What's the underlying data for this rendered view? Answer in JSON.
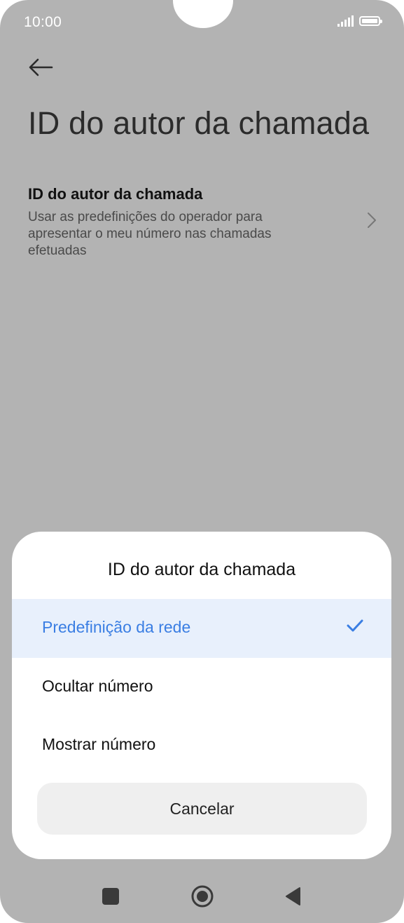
{
  "status_bar": {
    "time": "10:00",
    "signal_icon": "signal-icon",
    "battery_icon": "battery-icon"
  },
  "header": {
    "back_icon": "arrow-left-icon",
    "title": "ID do autor da chamada"
  },
  "setting": {
    "title": "ID do autor da chamada",
    "description": "Usar as predefinições do operador para apresentar o meu número nas chamadas efetuadas",
    "chevron_icon": "chevron-right-icon"
  },
  "dialog": {
    "title": "ID do autor da chamada",
    "options": [
      {
        "label": "Predefinição da rede",
        "selected": true
      },
      {
        "label": "Ocultar número",
        "selected": false
      },
      {
        "label": "Mostrar número",
        "selected": false
      }
    ],
    "check_icon": "checkmark-icon",
    "cancel_label": "Cancelar"
  },
  "nav_bar": {
    "recents_icon": "square-icon",
    "home_icon": "home-circle-icon",
    "back_icon": "triangle-back-icon"
  },
  "colors": {
    "accent": "#3a7ee3",
    "selected_bg": "#e8f0fc",
    "scrim": "#b3b3b3"
  }
}
